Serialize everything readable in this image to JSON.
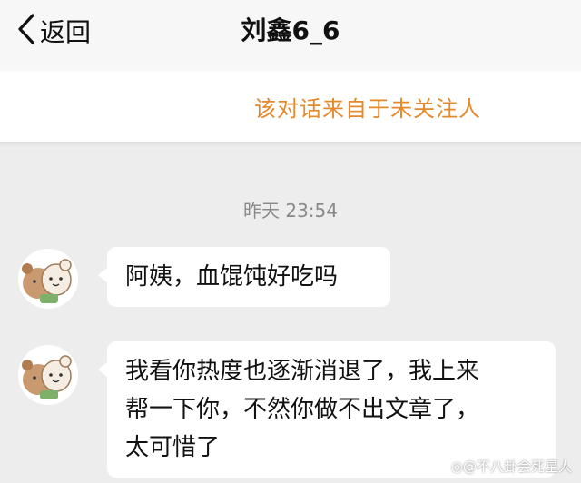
{
  "nav": {
    "back_label": "返回",
    "title": "刘鑫6_6"
  },
  "notice": {
    "text": "该对话来自于未关注人"
  },
  "chat": {
    "timestamp": "昨天 23:54",
    "messages": [
      {
        "lines": [
          "阿姨，血馄饨好吃吗"
        ]
      },
      {
        "lines": [
          "我看你热度也逐渐消退了，我上来",
          "帮一下你，不然你做不出文章了，",
          "太可惜了"
        ]
      }
    ]
  },
  "watermark": {
    "text": "不八卦会死星人"
  },
  "colors": {
    "notice_text": "#e38a2c",
    "background": "#ededed",
    "bubble": "#ffffff"
  }
}
